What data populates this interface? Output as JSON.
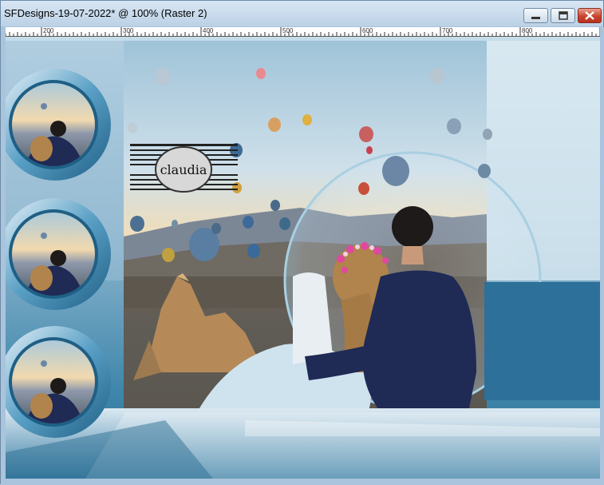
{
  "window": {
    "title": "SFDesigns-19-07-2022* @ 100% (Raster 2)",
    "buttons": {
      "minimize": "minimize-icon",
      "maximize": "maximize-icon",
      "close": "close-icon"
    }
  },
  "ruler": {
    "labels": [
      "200",
      "300",
      "400",
      "500",
      "600",
      "700",
      "800"
    ]
  },
  "canvas": {
    "watermark_text": "claudia"
  },
  "colors": {
    "title_bar": "#c8dbee",
    "canvas_blue": "#2b6f95",
    "sky_light": "#e8f2f8",
    "sunset": "#f2d6a8"
  }
}
